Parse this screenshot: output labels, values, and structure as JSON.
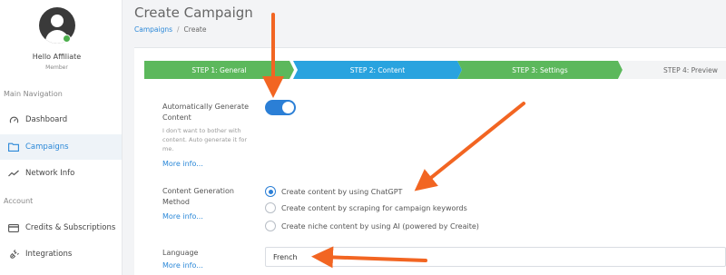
{
  "sidebar": {
    "user_name": "Hello Affiliate",
    "user_role": "Member",
    "sections": [
      {
        "label": "Main Navigation"
      },
      {
        "label": "Account"
      }
    ],
    "items": [
      {
        "label": "Dashboard",
        "icon": "dashboard-gauge-icon"
      },
      {
        "label": "Campaigns",
        "icon": "folder-icon",
        "active": true
      },
      {
        "label": "Network Info",
        "icon": "trend-line-icon"
      },
      {
        "label": "Credits & Subscriptions",
        "icon": "credit-card-icon"
      },
      {
        "label": "Integrations",
        "icon": "plug-icon"
      }
    ]
  },
  "header": {
    "title": "Create Campaign",
    "breadcrumb": {
      "link": "Campaigns",
      "separator": "/",
      "current": "Create"
    }
  },
  "wizard": {
    "steps": [
      {
        "label": "STEP 1: General",
        "state": "complete"
      },
      {
        "label": "STEP 2: Content",
        "state": "active"
      },
      {
        "label": "STEP 3: Settings",
        "state": "complete"
      },
      {
        "label": "STEP 4: Preview",
        "state": "pending"
      }
    ]
  },
  "form": {
    "auto_generate": {
      "label_line1": "Automatically Generate",
      "label_line2": "Content",
      "help_lines": [
        "I don't want to bother with",
        "content. Auto generate it for",
        "me."
      ],
      "more_info": "More info...",
      "enabled": true
    },
    "content_method": {
      "label_line1": "Content Generation",
      "label_line2": "Method",
      "more_info": "More info...",
      "options": [
        {
          "label": "Create content by using ChatGPT",
          "selected": true
        },
        {
          "label": "Create content by scraping for campaign keywords",
          "selected": false
        },
        {
          "label": "Create niche content by using AI (powered by Creaite)",
          "selected": false
        }
      ]
    },
    "language": {
      "label": "Language",
      "more_info": "More info...",
      "value": "French"
    }
  },
  "colors": {
    "accent": "#2b7fd6",
    "step_complete": "#5cb85c",
    "step_active": "#29a3df",
    "annotation_arrow": "#f26522"
  }
}
